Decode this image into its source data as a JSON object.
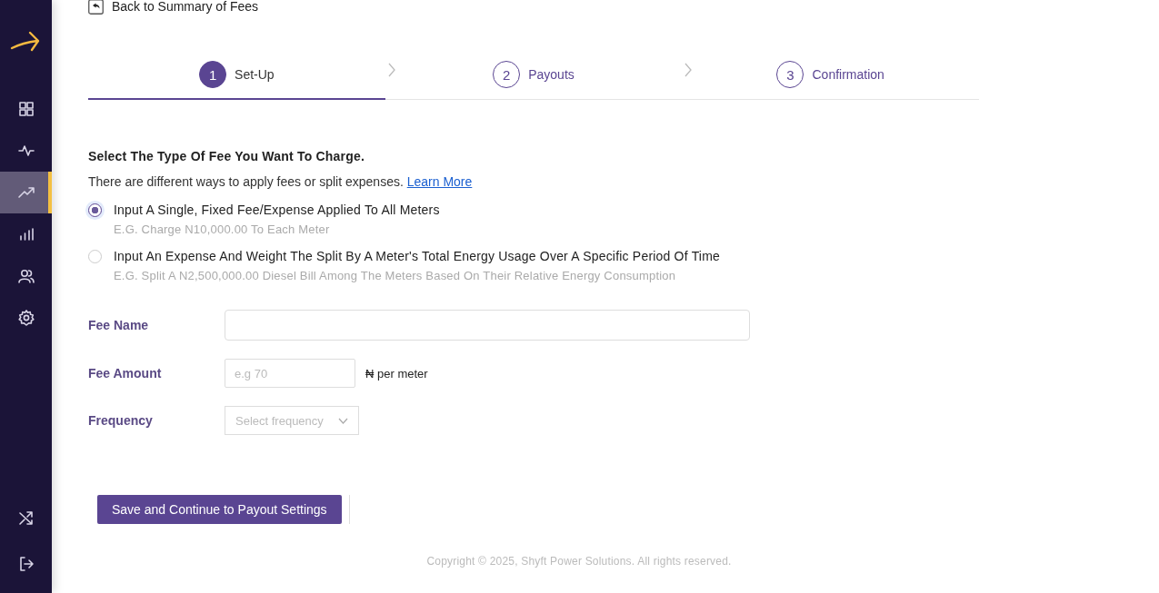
{
  "sidebar": {
    "top_items": [
      {
        "selected": false
      },
      {
        "selected": false
      },
      {
        "selected": true
      },
      {
        "selected": false
      },
      {
        "selected": false
      },
      {
        "selected": false
      }
    ],
    "bottom_items": [
      {
        "selected": false
      },
      {
        "selected": false
      }
    ]
  },
  "back_link": "Back to Summary of Fees",
  "steps": [
    {
      "number": "1",
      "label": "Set-Up",
      "selected": true
    },
    {
      "number": "2",
      "label": "Payouts",
      "selected": false
    },
    {
      "number": "3",
      "label": "Confirmation",
      "selected": false
    }
  ],
  "heading": "Select The Type Of Fee You Want To Charge.",
  "intro": "There are different ways to apply fees or split expenses.",
  "learn_more": "Learn More",
  "options": [
    {
      "label": "Input A Single, Fixed Fee/Expense Applied To All Meters",
      "example": "E.G. Charge N10,000.00 To Each Meter",
      "selected": true
    },
    {
      "label": "Input An Expense And Weight The Split By A Meter's Total Energy Usage Over A Specific Period Of Time",
      "example": "E.G. Split A N2,500,000.00 Diesel Bill Among The Meters Based On Their Relative Energy Consumption",
      "selected": false
    }
  ],
  "fields": [
    {
      "kind": "text",
      "label": "Fee Name"
    },
    {
      "kind": "amount",
      "label": "Fee Amount",
      "placeholder": "e.g 70",
      "unit": "₦ per meter"
    },
    {
      "kind": "select",
      "label": "Frequency",
      "placeholder": "Select frequency"
    }
  ],
  "save_button": "Save and Continue to Payout Settings",
  "footer": "Copyright © 2025, Shyft Power Solutions. All rights reserved."
}
